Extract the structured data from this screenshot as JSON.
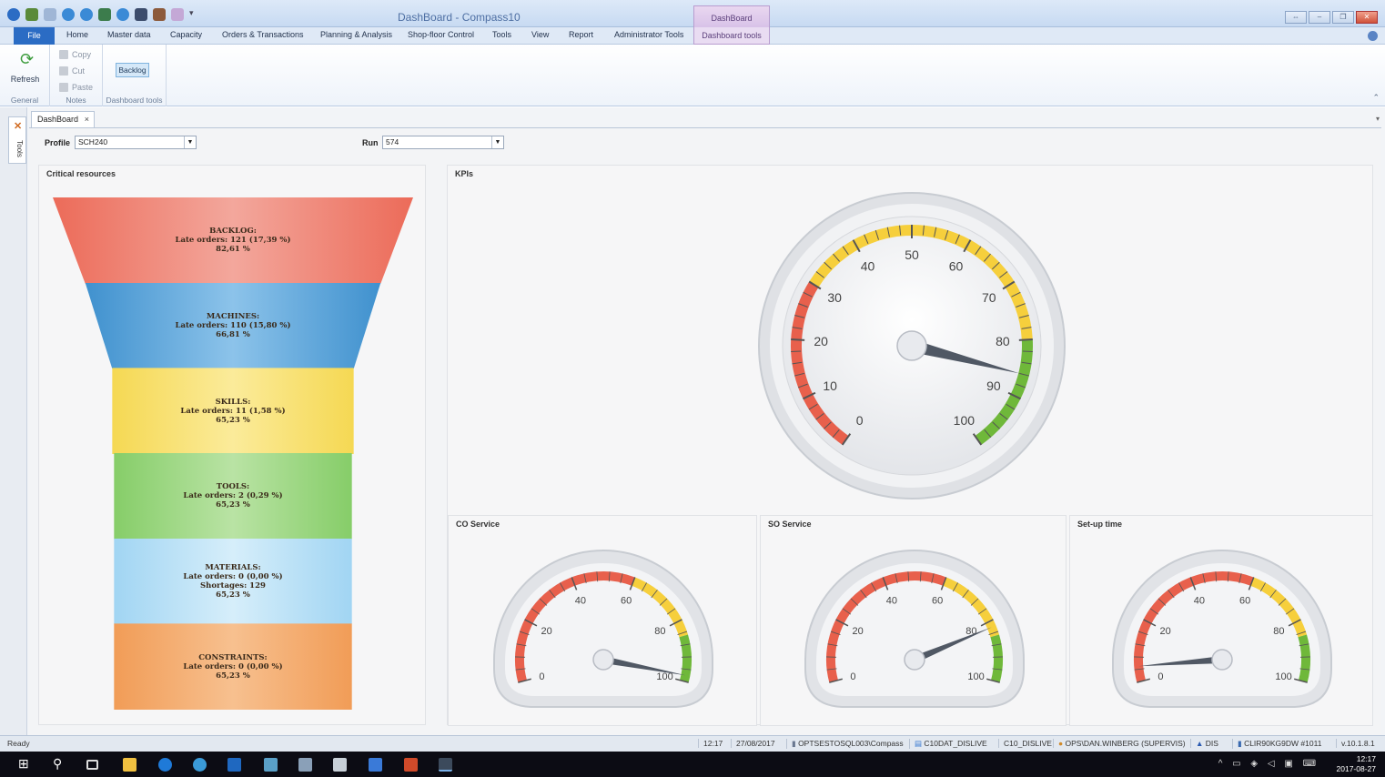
{
  "window": {
    "title": "DashBoard - Compass10",
    "context_tab_header": "DashBoard"
  },
  "menu": {
    "tabs": [
      "File",
      "Home",
      "Master data",
      "Capacity",
      "Orders & Transactions",
      "Planning & Analysis",
      "Shop-floor Control",
      "Tools",
      "View",
      "Report",
      "Administrator Tools",
      "Dashboard tools"
    ]
  },
  "ribbon": {
    "refresh_label": "Refresh",
    "copy_label": "Copy",
    "cut_label": "Cut",
    "paste_label": "Paste",
    "backlog_label": "Backlog",
    "groups": {
      "general": "General",
      "notes": "Notes",
      "dashboard_tools": "Dashboard tools"
    }
  },
  "side": {
    "tools_label": "Tools"
  },
  "doc_tab": {
    "label": "DashBoard",
    "close": "×"
  },
  "filters": {
    "profile_label": "Profile",
    "profile_value": "SCH240",
    "run_label": "Run",
    "run_value": "574"
  },
  "critical_resources": {
    "title": "Critical resources",
    "segments": [
      {
        "name": "BACKLOG:",
        "lines": [
          "Late orders: 121 (17,39 %)",
          "82,61 %"
        ],
        "color_top": "#ec6b59",
        "color_mid": "#f3a79c"
      },
      {
        "name": "MACHINES:",
        "lines": [
          "Late orders: 110 (15,80 %)",
          "66,81 %"
        ],
        "color_top": "#2f86c8",
        "color_mid": "#8cc3ea"
      },
      {
        "name": "SKILLS:",
        "lines": [
          "Late orders: 11 (1,58 %)",
          "65,23 %"
        ],
        "color_top": "#f2cf30",
        "color_mid": "#fbeb9a"
      },
      {
        "name": "TOOLS:",
        "lines": [
          "Late orders: 2 (0,29 %)",
          "65,23 %"
        ],
        "color_top": "#6cc24a",
        "color_mid": "#b9e3a4"
      },
      {
        "name": "MATERIALS:",
        "lines": [
          "Late orders: 0 (0,00 %)",
          "Shortages: 129",
          "65,23 %"
        ],
        "color_top": "#86c8ef",
        "color_mid": "#d6eefa"
      },
      {
        "name": "CONSTRAINTS:",
        "lines": [
          "Late orders: 0 (0,00 %)",
          "65,23 %"
        ],
        "color_top": "#ee8a3a",
        "color_mid": "#f7c08f"
      }
    ]
  },
  "kpis": {
    "title": "KPIs",
    "main_gauge": {
      "value": 86,
      "min": 0,
      "max": 100,
      "ticks": [
        "0",
        "10",
        "20",
        "30",
        "40",
        "50",
        "60",
        "70",
        "80",
        "90",
        "100"
      ]
    },
    "small_gauges": [
      {
        "title": "CO Service",
        "value": 98,
        "ticks": [
          "0",
          "20",
          "40",
          "60",
          "80",
          "100"
        ]
      },
      {
        "title": "SO Service",
        "value": 82,
        "ticks": [
          "0",
          "20",
          "40",
          "60",
          "80",
          "100"
        ]
      },
      {
        "title": "Set-up time",
        "value": 5,
        "ticks": [
          "0",
          "20",
          "40",
          "60",
          "80",
          "100"
        ]
      }
    ],
    "colors": {
      "red": "#e8604c",
      "yellow": "#f6cf3c",
      "green": "#6fb83a"
    }
  },
  "statusbar": {
    "status": "Ready",
    "time": "12:17",
    "date": "27/08/2017",
    "server": "OPTSESTOSQL003\\Compass",
    "database": "C10DAT_DISLIVE",
    "schema": "C10_DISLIVE",
    "user": "OPS\\DAN.WINBERG (SUPERVIS)",
    "company": "DIS",
    "machine": "CLIR90KG9DW #1011",
    "version": "v.10.1.8.1"
  },
  "taskbar": {
    "clock_time": "12:17",
    "clock_date": "2017-08-27"
  }
}
